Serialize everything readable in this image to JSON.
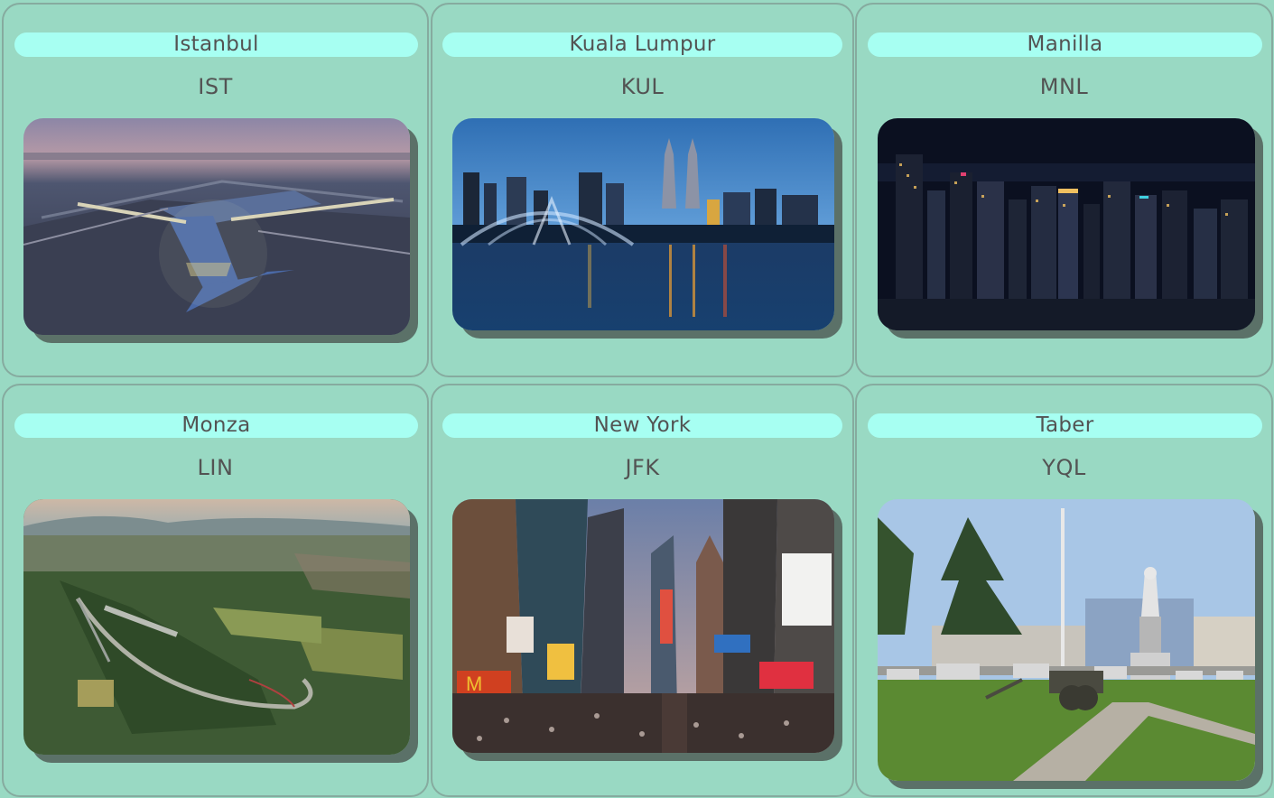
{
  "destinations": [
    {
      "city": "Istanbul",
      "code": "IST",
      "photo_icon": "istanbul-airport-aerial-photo"
    },
    {
      "city": "Kuala Lumpur",
      "code": "KUL",
      "photo_icon": "kuala-lumpur-skyline-photo"
    },
    {
      "city": "Manilla",
      "code": "MNL",
      "photo_icon": "manila-night-skyline-photo"
    },
    {
      "city": "Monza",
      "code": "LIN",
      "photo_icon": "monza-circuit-aerial-photo"
    },
    {
      "city": "New York",
      "code": "JFK",
      "photo_icon": "times-square-photo"
    },
    {
      "city": "Taber",
      "code": "YQL",
      "photo_icon": "taber-town-park-photo"
    }
  ],
  "colors": {
    "page_background": "#99d9c3",
    "card_border": "#86ab9f",
    "title_pill": "#a7fff2",
    "text": "#535353",
    "photo_shadow": "#5b7168"
  }
}
